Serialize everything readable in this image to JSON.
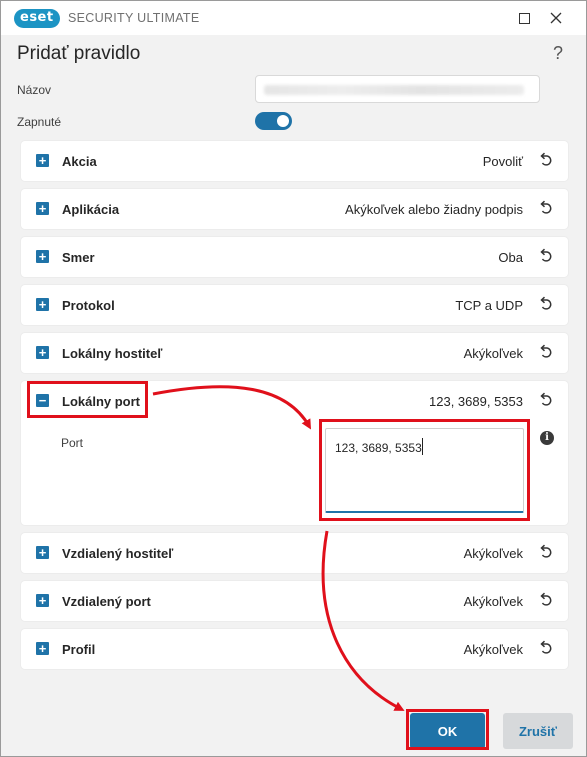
{
  "window": {
    "logo_text": "eset",
    "app_title": "SECURITY ULTIMATE",
    "maximize_icon": "maximize-icon",
    "close_icon": "close-icon"
  },
  "dialog": {
    "title": "Pridať pravidlo",
    "help_label": "?"
  },
  "form": {
    "name_label": "Názov",
    "name_value_hidden": true,
    "enabled_label": "Zapnuté",
    "enabled": true
  },
  "rules": [
    {
      "label": "Akcia",
      "value": "Povoliť",
      "expanded": false
    },
    {
      "label": "Aplikácia",
      "value": "Akýkoľvek alebo žiadny podpis",
      "expanded": false
    },
    {
      "label": "Smer",
      "value": "Oba",
      "expanded": false
    },
    {
      "label": "Protokol",
      "value": "TCP a UDP",
      "expanded": false
    },
    {
      "label": "Lokálny hostiteľ",
      "value": "Akýkoľvek",
      "expanded": false
    },
    {
      "label": "Lokálny port",
      "value": "123, 3689, 5353",
      "expanded": true,
      "sub_label": "Port",
      "input_value": "123, 3689, 5353"
    },
    {
      "label": "Vzdialený hostiteľ",
      "value": "Akýkoľvek",
      "expanded": false
    },
    {
      "label": "Vzdialený port",
      "value": "Akýkoľvek",
      "expanded": false
    },
    {
      "label": "Profil",
      "value": "Akýkoľvek",
      "expanded": false
    }
  ],
  "icons": {
    "expand": "plus-icon",
    "collapse": "minus-icon",
    "reset": "undo-icon",
    "info": "info-icon"
  },
  "buttons": {
    "ok_label": "OK",
    "cancel_label": "Zrušiť"
  },
  "colors": {
    "accent": "#1f73a8",
    "annotation": "#e0101b",
    "brand": "#1c94c4"
  }
}
